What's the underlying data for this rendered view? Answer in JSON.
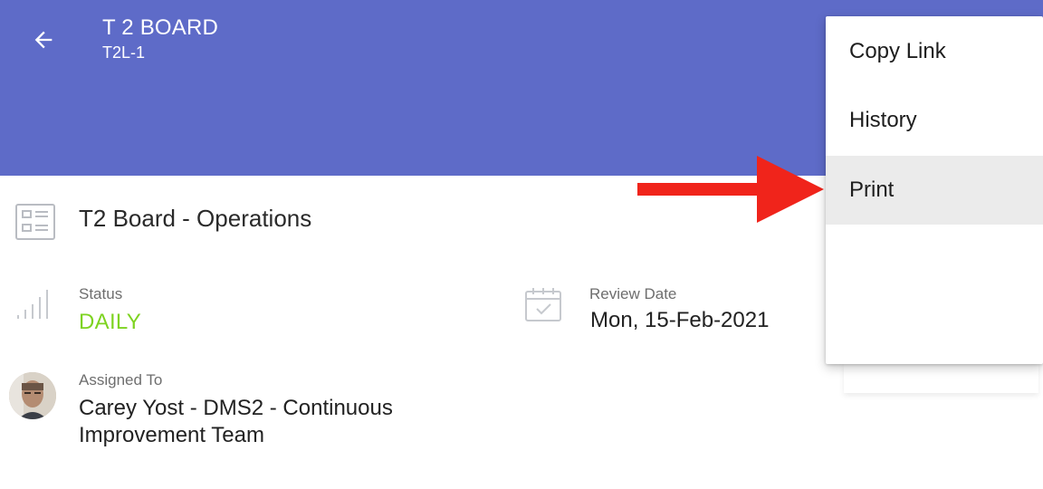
{
  "header": {
    "title": "T 2 BOARD",
    "subtitle": "T2L-1",
    "background": "#5e6bc8"
  },
  "board": {
    "name": "T2 Board - Operations",
    "icon": "board-list-icon"
  },
  "status": {
    "label": "Status",
    "value": "DAILY",
    "color": "#7ed321",
    "icon": "signal-bars-icon"
  },
  "review": {
    "label": "Review Date",
    "value": "Mon, 15-Feb-2021",
    "icon": "calendar-check-icon"
  },
  "assigned": {
    "label": "Assigned To",
    "value": "Carey Yost - DMS2 - Continuous Improvement Team"
  },
  "menu": {
    "items": [
      {
        "label": "Copy Link"
      },
      {
        "label": "History"
      },
      {
        "label": "Print",
        "highlighted": true
      }
    ]
  },
  "annotation": {
    "arrow_color": "#f0241b"
  }
}
